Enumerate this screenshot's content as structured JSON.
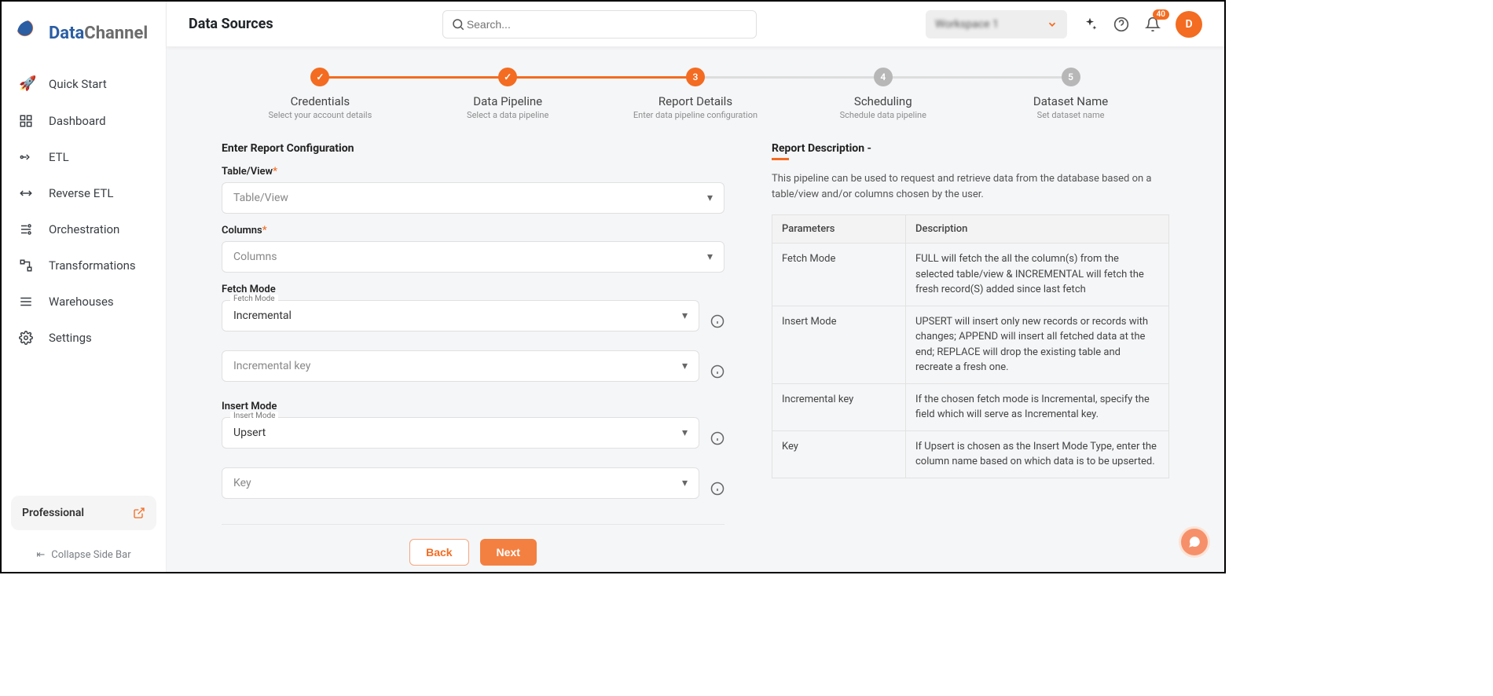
{
  "brand": {
    "part1": "Data",
    "part2": "Channel"
  },
  "sidebar": {
    "items": [
      {
        "label": "Quick Start"
      },
      {
        "label": "Dashboard"
      },
      {
        "label": "ETL"
      },
      {
        "label": "Reverse ETL"
      },
      {
        "label": "Orchestration"
      },
      {
        "label": "Transformations"
      },
      {
        "label": "Warehouses"
      },
      {
        "label": "Settings"
      }
    ],
    "plan": {
      "label": "Professional"
    },
    "collapse": "Collapse Side Bar"
  },
  "header": {
    "title": "Data Sources",
    "search_placeholder": "Search...",
    "workspace": "Workspace 1",
    "notif_count": "40",
    "avatar_initial": "D"
  },
  "stepper": [
    {
      "title": "Credentials",
      "sub": "Select your account details",
      "state": "done",
      "mark": "✓"
    },
    {
      "title": "Data Pipeline",
      "sub": "Select a data pipeline",
      "state": "done",
      "mark": "✓"
    },
    {
      "title": "Report Details",
      "sub": "Enter data pipeline configuration",
      "state": "active",
      "mark": "3"
    },
    {
      "title": "Scheduling",
      "sub": "Schedule data pipeline",
      "state": "todo",
      "mark": "4"
    },
    {
      "title": "Dataset Name",
      "sub": "Set dataset name",
      "state": "todo",
      "mark": "5"
    }
  ],
  "form": {
    "heading": "Enter Report Configuration",
    "table_view": {
      "label": "Table/View",
      "placeholder": "Table/View"
    },
    "columns": {
      "label": "Columns",
      "placeholder": "Columns"
    },
    "fetch_mode": {
      "label": "Fetch Mode",
      "float": "Fetch Mode",
      "value": "Incremental"
    },
    "incremental_key": {
      "placeholder": "Incremental key"
    },
    "insert_mode": {
      "label": "Insert Mode",
      "float": "Insert Mode",
      "value": "Upsert"
    },
    "key": {
      "placeholder": "Key"
    },
    "back": "Back",
    "next": "Next"
  },
  "description": {
    "heading": "Report Description -",
    "text": "This pipeline can be used to request and retrieve data from the database based on a table/view and/or columns chosen by the user.",
    "param_col": "Parameters",
    "desc_col": "Description",
    "rows": [
      {
        "p": "Fetch Mode",
        "d": "FULL will fetch the all the column(s) from the selected table/view & INCREMENTAL will fetch the fresh record(S) added since last fetch"
      },
      {
        "p": "Insert Mode",
        "d": "UPSERT will insert only new records or records with changes; APPEND will insert all fetched data at the end; REPLACE will drop the existing table and recreate a fresh one."
      },
      {
        "p": "Incremental key",
        "d": "If the chosen fetch mode is Incremental, specify the field which will serve as Incremental key."
      },
      {
        "p": "Key",
        "d": "If Upsert is chosen as the Insert Mode Type, enter the column name based on which data is to be upserted."
      }
    ]
  }
}
